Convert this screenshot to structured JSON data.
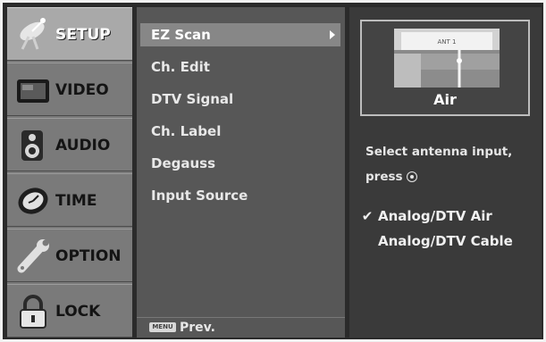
{
  "nav": {
    "items": [
      {
        "label": "SETUP",
        "icon": "satellite-dish-icon",
        "active": true
      },
      {
        "label": "VIDEO",
        "icon": "tv-screen-icon",
        "active": false
      },
      {
        "label": "AUDIO",
        "icon": "speaker-icon",
        "active": false
      },
      {
        "label": "TIME",
        "icon": "clock-icon",
        "active": false
      },
      {
        "label": "OPTION",
        "icon": "wrench-icon",
        "active": false
      },
      {
        "label": "LOCK",
        "icon": "padlock-icon",
        "active": false
      }
    ]
  },
  "menu": {
    "items": [
      {
        "label": "EZ Scan",
        "selected": true,
        "has_submenu": true
      },
      {
        "label": "Ch. Edit",
        "selected": false
      },
      {
        "label": "DTV Signal",
        "selected": false
      },
      {
        "label": "Ch. Label",
        "selected": false
      },
      {
        "label": "Degauss",
        "selected": false
      },
      {
        "label": "Input Source",
        "selected": false
      }
    ],
    "footer": {
      "button_label": "MENU",
      "label": "Prev."
    }
  },
  "info": {
    "preview_label": "Air",
    "preview_sign": "ANT 1",
    "instruction_line1": "Select antenna input,",
    "instruction_line2": "press",
    "options": [
      {
        "label": "Analog/DTV Air",
        "checked": true
      },
      {
        "label": "Analog/DTV Cable",
        "checked": false
      }
    ]
  },
  "colors": {
    "nav_bg": "#7a7a7a",
    "nav_active_bg": "#a9a9a9",
    "menu_bg": "#575757",
    "menu_highlight": "#878787",
    "panel_bg": "#3a3a3a",
    "frame": "#2b2b2b"
  }
}
